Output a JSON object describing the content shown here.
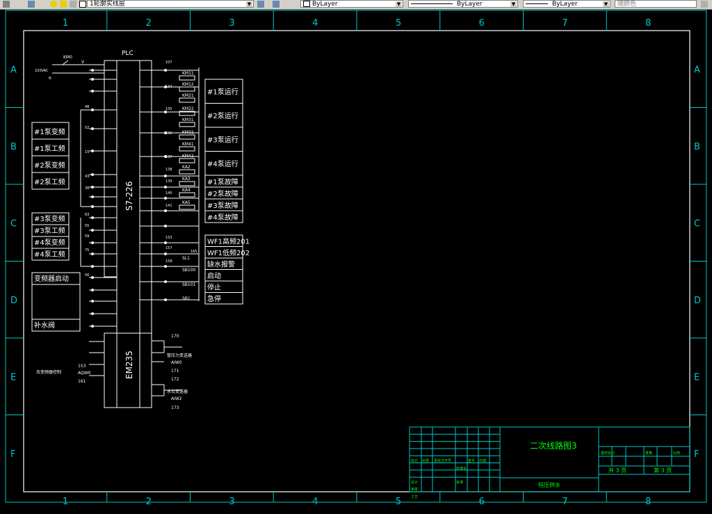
{
  "toolbar": {
    "layer_name": "1轮廓实线层",
    "color": "ByLayer",
    "linetype": "ByLayer",
    "lineweight": "ByLayer",
    "plotstyle": "随颜色"
  },
  "frame": {
    "columns": [
      "1",
      "2",
      "3",
      "4",
      "5",
      "6",
      "7",
      "8"
    ],
    "rows": [
      "A",
      "B",
      "C",
      "D",
      "E",
      "F"
    ]
  },
  "drawing": {
    "plc_label": "PLC",
    "cpu_model": "S7-226",
    "em_model": "EM235",
    "km0": "KM0",
    "v_label": "V",
    "supply": "220VAC",
    "n_label": "N",
    "left_boxes_1": [
      "#1泵变频",
      "#1泵工频",
      "#2泵变频",
      "#2泵工频"
    ],
    "left_boxes_2": [
      "#3泵变频",
      "#3泵工频",
      "#4泵变频",
      "#4泵工频"
    ],
    "left_boxes_3_top": "变频器启动",
    "left_boxes_3_bottom": "补水阀",
    "left_wire_labels": [
      "48",
      "52",
      "15",
      "43",
      "36",
      "63",
      "55",
      "59",
      "75",
      "56"
    ],
    "right_boxes_run": [
      "#1泵运行",
      "#2泵运行",
      "#3泵运行",
      "#4泵运行"
    ],
    "right_boxes_fault": [
      "#1泵故障",
      "#2泵故障",
      "#3泵故障",
      "#4泵故障"
    ],
    "right_boxes_io": [
      "WF1高频201",
      "WF1低频202",
      "缺水报警",
      "启动",
      "停止",
      "急停"
    ],
    "relay_labels": [
      "KM11",
      "KM12",
      "KM21",
      "KM22",
      "KM31",
      "KM32",
      "KM41",
      "KM42",
      "KA2",
      "KA3",
      "KA4",
      "KA5"
    ],
    "switch_labels": [
      "SL1",
      "SB100",
      "SB101",
      "SB1"
    ],
    "wire_numbers_right": [
      "107",
      "134",
      "135",
      "136",
      "137",
      "138",
      "139",
      "140",
      "141",
      "153",
      "157",
      "158",
      "165"
    ],
    "em_label_left": "去变频器控制",
    "em_nums_left": [
      "153",
      "AQW0",
      "161"
    ],
    "sensor1_name": "管压力变送器",
    "sensor1_sig": "AIW0",
    "sensor2_name": "水位变送器",
    "sensor2_sig": "AIW2",
    "sensor_nums": [
      "170",
      "171",
      "172",
      "173"
    ]
  },
  "title_block": {
    "drawing_title": "二次线路图3",
    "company": "恒压供水",
    "sheet_total_label": "共 3 页",
    "sheet_no_label": "第 3 页",
    "labels": [
      "标记",
      "处数",
      "更改文件号",
      "签字",
      "日期",
      "设计",
      "标准化",
      "审核",
      "工艺",
      "批准"
    ],
    "right_labels": [
      "图样标记",
      "重量",
      "比例"
    ]
  },
  "colors": {
    "frame": "#00c8c8",
    "linework": "#ffffff",
    "grid_text": "#00c8c8",
    "toolbar_bg": "#d4d0c8",
    "title_text": "#00ff00"
  }
}
